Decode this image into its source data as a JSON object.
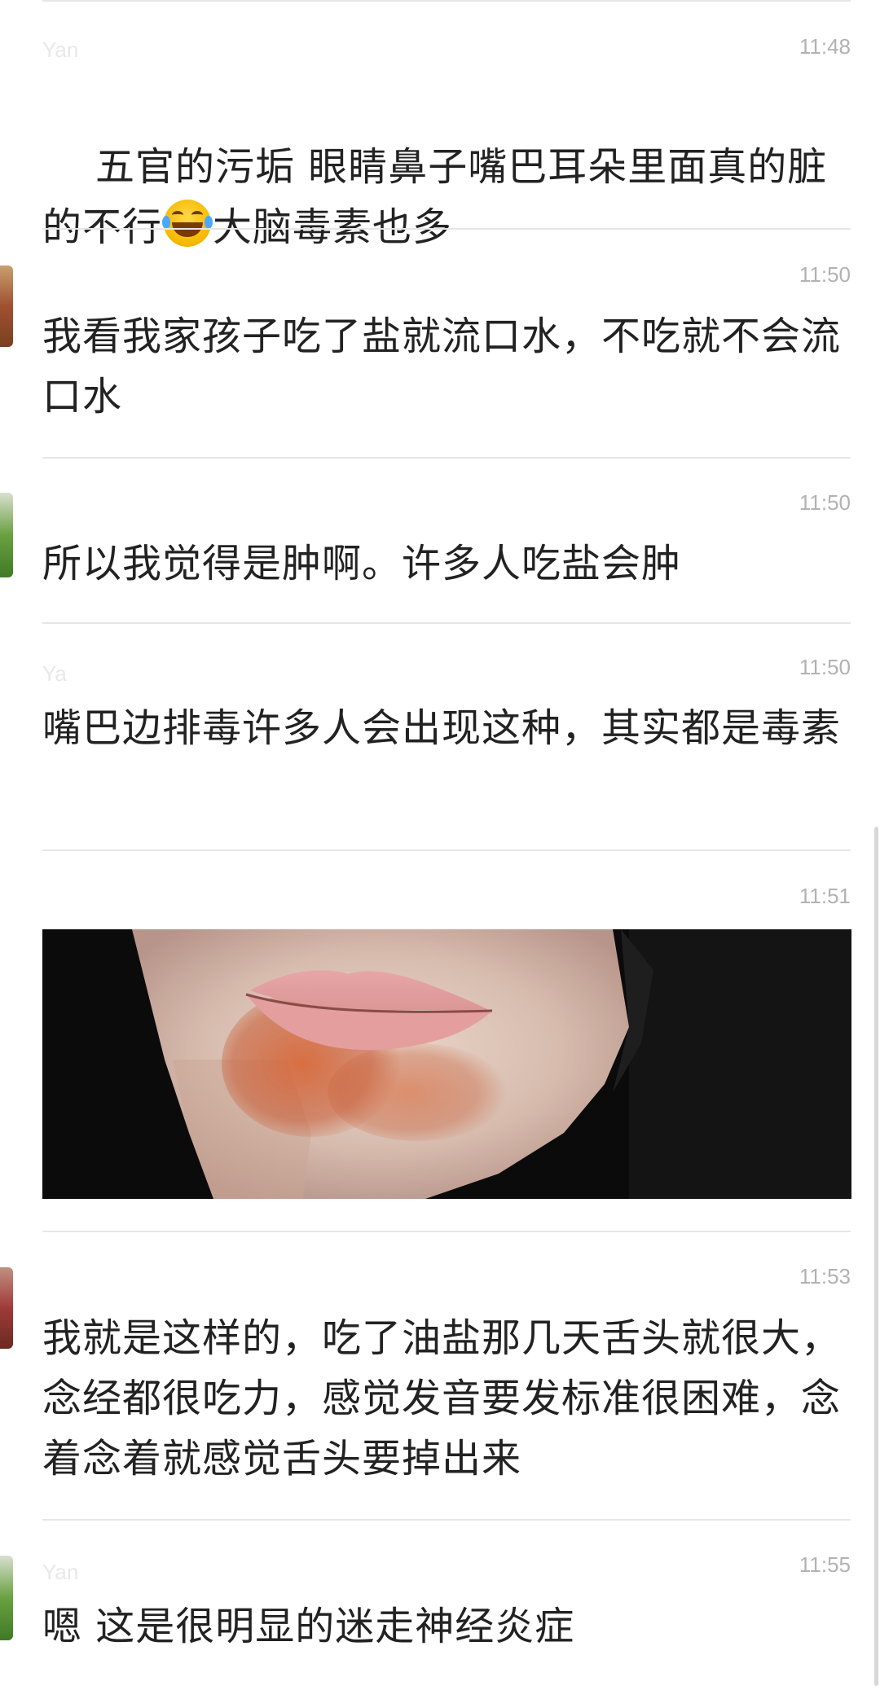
{
  "messages": [
    {
      "name": "Yan",
      "time": "11:48",
      "text_before_emoji": "五官的污垢 眼睛鼻子嘴巴耳朵里面真的脏的不行",
      "emoji": "face-with-tears-of-joy",
      "text_after_emoji": "大脑毒素也多"
    },
    {
      "name": "",
      "time": "11:50",
      "text": "我看我家孩子吃了盐就流口水，不吃就不会流口水"
    },
    {
      "name": "",
      "time": "11:50",
      "text": "所以我觉得是肿啊。许多人吃盐会肿"
    },
    {
      "name": "Ya",
      "time": "11:50",
      "text": "嘴巴边排毒许多人会出现这种，其实都是毒素"
    },
    {
      "name": "",
      "time": "11:51",
      "image": "photo-of-chin-with-rash"
    },
    {
      "name": "",
      "time": "11:53",
      "text": "我就是这样的，吃了油盐那几天舌头就很大，念经都很吃力，感觉发音要发标准很困难，念着念着就感觉舌头要掉出来"
    },
    {
      "name": "Yan",
      "time": "11:55",
      "text": "嗯 这是很明显的迷走神经炎症"
    }
  ],
  "colors": {
    "text": "#222222",
    "time": "#b2b2b2",
    "separator": "#e6e6e6",
    "background": "#ffffff"
  }
}
